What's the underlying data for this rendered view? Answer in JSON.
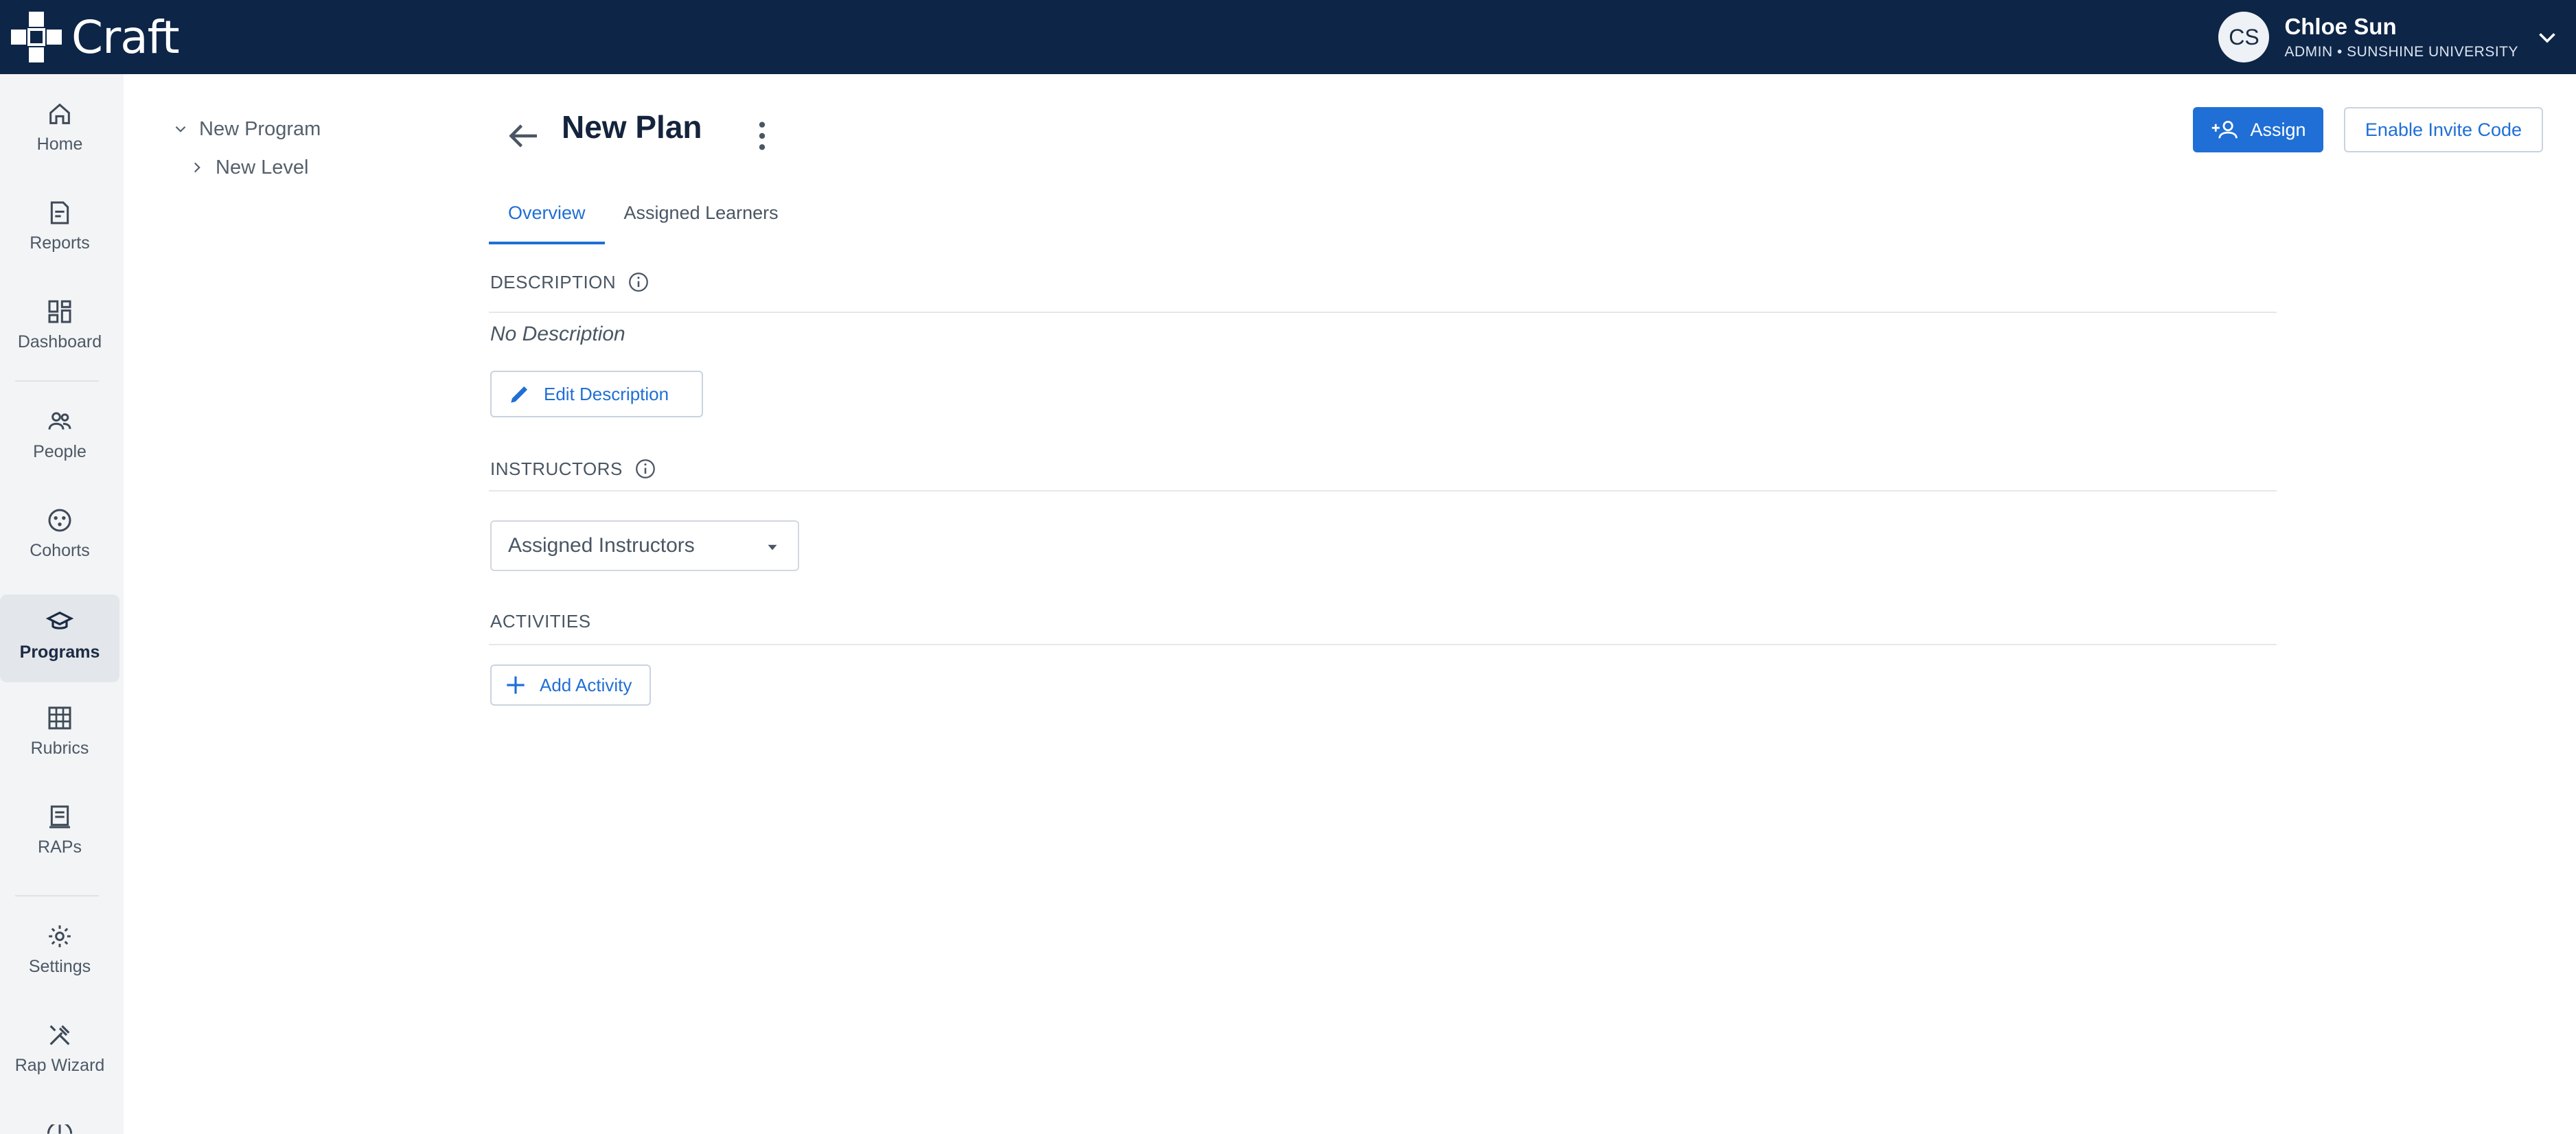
{
  "app": {
    "name": "Craft"
  },
  "user": {
    "initials": "CS",
    "name": "Chloe Sun",
    "role": "ADMIN • SUNSHINE UNIVERSITY"
  },
  "nav": {
    "items": [
      {
        "label": "Home",
        "icon": "home-icon"
      },
      {
        "label": "Reports",
        "icon": "reports-icon"
      },
      {
        "label": "Dashboard",
        "icon": "dashboard-icon"
      },
      {
        "label": "People",
        "icon": "people-icon"
      },
      {
        "label": "Cohorts",
        "icon": "cohorts-icon"
      },
      {
        "label": "Programs",
        "icon": "programs-icon",
        "active": true
      },
      {
        "label": "Rubrics",
        "icon": "rubrics-icon"
      },
      {
        "label": "RAPs",
        "icon": "raps-icon"
      },
      {
        "label": "Settings",
        "icon": "gear-icon"
      },
      {
        "label": "Rap Wizard",
        "icon": "tools-icon"
      }
    ]
  },
  "tree": {
    "program": "New Program",
    "level": "New Level"
  },
  "page": {
    "title": "New Plan",
    "tabs": [
      {
        "label": "Overview",
        "active": true
      },
      {
        "label": "Assigned Learners"
      }
    ],
    "assign_label": "Assign",
    "invite_label": "Enable Invite Code"
  },
  "description": {
    "label": "DESCRIPTION",
    "value": "No Description",
    "edit_label": "Edit Description"
  },
  "instructors": {
    "label": "INSTRUCTORS",
    "select_value": "Assigned Instructors"
  },
  "activities": {
    "label": "ACTIVITIES",
    "add_label": "Add Activity"
  },
  "colors": {
    "topbar": "#0d2547",
    "accent": "#1f6fd6"
  }
}
